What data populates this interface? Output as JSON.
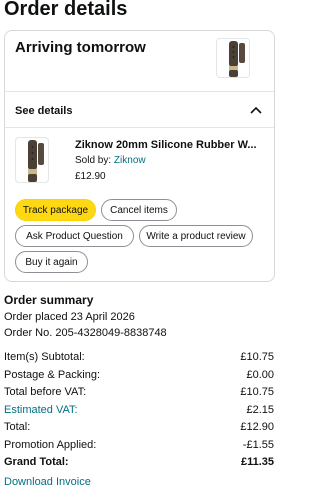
{
  "page": {
    "title": "Order details"
  },
  "shipment": {
    "status": "Arriving tomorrow",
    "see_details_label": "See details"
  },
  "item": {
    "title": "Ziknow 20mm Silicone Rubber W...",
    "sold_by_label": "Sold by: ",
    "seller": "Ziknow",
    "price": "£12.90"
  },
  "actions": {
    "track": "Track package",
    "cancel": "Cancel items",
    "ask": "Ask Product Question",
    "review": "Write a product review",
    "buy_again": "Buy it again"
  },
  "summary": {
    "title": "Order summary",
    "placed": "Order placed 23 April 2026",
    "order_no": "Order No. 205-4328049-8838748",
    "rows": [
      {
        "label": "Item(s) Subtotal:",
        "value": "£10.75"
      },
      {
        "label": "Postage & Packing:",
        "value": "£0.00"
      },
      {
        "label": "Total before VAT:",
        "value": "£10.75"
      },
      {
        "label": "Estimated VAT:",
        "value": "£2.15"
      },
      {
        "label": "Total:",
        "value": "£12.90"
      },
      {
        "label": "Promotion Applied:",
        "value": "-£1.55"
      },
      {
        "label": "Grand Total:",
        "value": "£11.35"
      }
    ],
    "download_invoice": "Download Invoice"
  },
  "colors": {
    "link": "#007185",
    "primary_button": "#ffd814",
    "border": "#d5d9d9"
  },
  "icons": {
    "thumbnail": "watch-strap-icon",
    "collapse": "chevron-up-icon"
  }
}
